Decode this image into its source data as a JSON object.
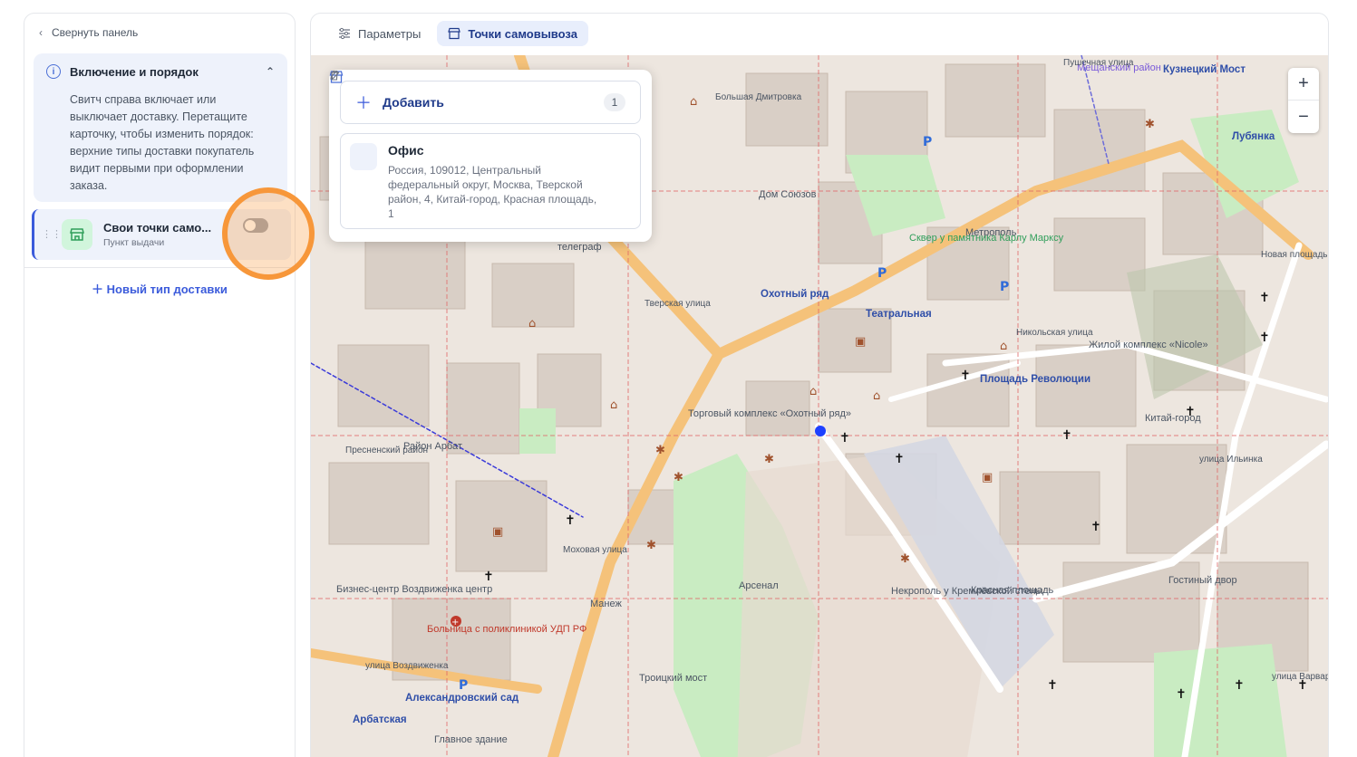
{
  "sidebar": {
    "collapse_label": "Свернуть панель",
    "info": {
      "title": "Включение и порядок",
      "text": "Свитч справа включает или выключает доставку. Перетащите карточку, чтобы изменить порядок: верхние типы доставки покупатель видит первыми при оформлении заказа."
    },
    "delivery_card": {
      "title": "Свои точки само...",
      "subtitle": "Пункт выдачи",
      "enabled": false
    },
    "new_type_label": "Новый тип доставки"
  },
  "tabs": [
    {
      "label": "Параметры",
      "active": false
    },
    {
      "label": "Точки самовывоза",
      "active": true
    }
  ],
  "pickup_panel": {
    "add_label": "Добавить",
    "count": "1",
    "point": {
      "title": "Офис",
      "address": "Россия, 109012, Центральный федеральный округ, Москва, Тверской район, 4, Китай-город, Красная площадь, 1"
    }
  },
  "map": {
    "zoom_in": "+",
    "zoom_out": "−",
    "labels": {
      "kuznetsky": "Кузнецкий Мост",
      "lubyanka": "Лубянка",
      "okhotny": "Охотный ряд",
      "teatralnaya": "Театральная",
      "ploshchad": "Площадь Революции",
      "metropol": "Метрополь",
      "dom_soyuzov": "Дом Союзов",
      "kitay_gorod": "Китай-город",
      "krasnaya": "Красная площадь",
      "arsenal": "Арсенал",
      "manezh": "Манеж",
      "troitsky": "Троицкий мост",
      "alexandrovsky": "Александровский сад",
      "arbatskaya": "Арбатская",
      "hospital": "Больница с поликлиникой УДП РФ",
      "gostiny": "Гостиный двор",
      "nicole": "Жилой комплекс «Nicole»",
      "torgovy": "Торговый комплекс «Охотный ряд»",
      "business": "Бизнес-центр Воздвиженка центр",
      "glavnoe": "Главное здание",
      "telegraf": "телеграф",
      "nekropol": "Некрополь у Кремлёвской стены",
      "tverskaya_street": "Тверская улица",
      "mokhovaya": "Моховая улица",
      "nikolskaya": "Никольская улица",
      "ilyinka": "улица Ильинка",
      "varvarka": "улица Варварка",
      "vozdvizhenka": "улица Воздвиженка",
      "novaya_ploshchad": "Новая площадь",
      "pushechnaya": "Пушечная улица",
      "bolshaya_dmitrovka": "Большая Дмитровка",
      "district_arbat": "Район Арбат",
      "district_presnensky": "Пресненский район",
      "district_meshchansky": "Мещанский район",
      "skver": "Сквер у памятника Карлу Марксу"
    }
  },
  "colors": {
    "accent": "#3b5bdb",
    "highlight": "#f7973a",
    "map_bg": "#ede6df",
    "road_orange": "#f5c27a",
    "park_green": "#c9ecc2"
  }
}
